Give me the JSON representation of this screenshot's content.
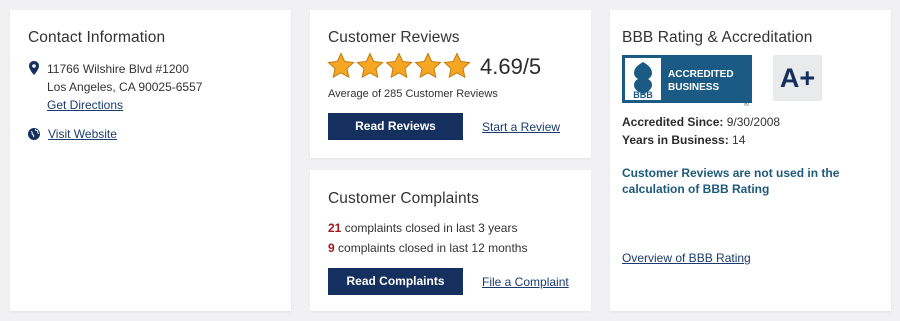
{
  "contact": {
    "title": "Contact Information",
    "address_line1": "11766 Wilshire Blvd #1200",
    "address_line2": "Los Angeles, CA 90025-6557",
    "directions_label": "Get Directions",
    "website_label": "Visit Website",
    "icons": {
      "address": "map-pin-icon",
      "website": "globe-icon"
    }
  },
  "reviews": {
    "title": "Customer Reviews",
    "rating": "4.69/5",
    "rating_value": 4.69,
    "stars_filled": 5,
    "stars_total": 5,
    "average_text": "Average of 285 Customer Reviews",
    "read_button": "Read Reviews",
    "start_link": "Start a Review"
  },
  "complaints": {
    "title": "Customer Complaints",
    "line1_count": "21",
    "line1_text": " complaints closed in last 3 years",
    "line2_count": "9",
    "line2_text": " complaints closed in last 12 months",
    "read_button": "Read Complaints",
    "file_link": "File a Complaint"
  },
  "bbb": {
    "title": "BBB Rating & Accreditation",
    "seal_line1": "ACCREDITED",
    "seal_line2": "BUSINESS",
    "seal_logo": "BBB",
    "grade": "A+",
    "accredited_label": "Accredited Since:",
    "accredited_value": " 9/30/2008",
    "years_label": "Years in Business:",
    "years_value": " 14",
    "notice": "Customer Reviews are not used in the calculation of BBB Rating",
    "overview_link": "Overview of BBB Rating"
  },
  "colors": {
    "navy": "#15305f",
    "star": "#f5a623",
    "complaint_count": "#a31820",
    "notice": "#1d5a7a",
    "seal_blue": "#1b5a84"
  }
}
